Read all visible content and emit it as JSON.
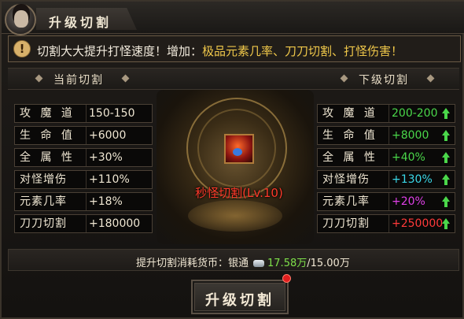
{
  "window": {
    "title": "升级切割"
  },
  "notice": {
    "text_white": "切割大大提升打怪速度！增加：",
    "text_gold": "极品元素几率、刀刀切割、打怪伤害！"
  },
  "current": {
    "header": "当前切割",
    "stats": [
      {
        "label": "攻 魔 道",
        "value": "150-150"
      },
      {
        "label": "生 命 值",
        "value": "+6000"
      },
      {
        "label": "全 属 性",
        "value": "+30%"
      },
      {
        "label": "对怪增伤",
        "value": "+110%"
      },
      {
        "label": "元素几率",
        "value": "+18%"
      },
      {
        "label": "刀刀切割",
        "value": "+180000"
      }
    ]
  },
  "next": {
    "header": "下级切割",
    "stats": [
      {
        "label": "攻 魔 道",
        "value": "200-200",
        "color": "#4ad74a"
      },
      {
        "label": "生 命 值",
        "value": "+8000",
        "color": "#4ad74a"
      },
      {
        "label": "全 属 性",
        "value": "+40%",
        "color": "#4ad74a"
      },
      {
        "label": "对怪增伤",
        "value": "+130%",
        "color": "#3ad8e8"
      },
      {
        "label": "元素几率",
        "value": "+20%",
        "color": "#e040e8"
      },
      {
        "label": "刀刀切割",
        "value": "+250000",
        "color": "#ff3a3a"
      }
    ]
  },
  "skill": {
    "name": "秒怪切割(Lv.10)",
    "icon": "skill-fire-icon"
  },
  "cost": {
    "label": "提升切割消耗货币：银通",
    "currency_icon": "silver-ingot-icon",
    "owned": "17.58万",
    "required": "/15.00万"
  },
  "upgrade_button": {
    "label": "升级切割"
  },
  "colors": {
    "accent_gold": "#f0c84a",
    "increase_green": "#4ad74a",
    "skill_red": "#ff3a2a"
  }
}
